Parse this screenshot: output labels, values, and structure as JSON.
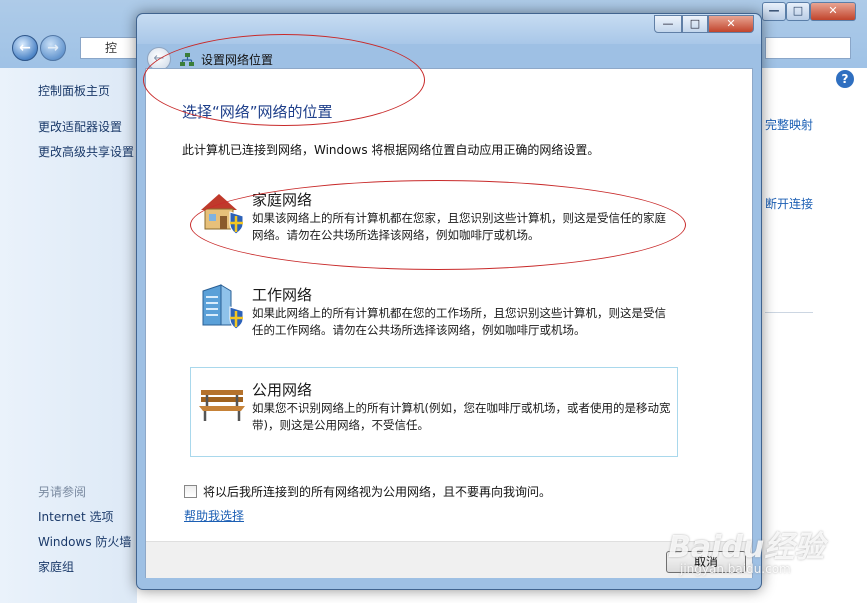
{
  "background_window": {
    "address_text": "控",
    "sidebar": {
      "home": "控制面板主页",
      "links": [
        "更改适配器设置",
        "更改高级共享设置"
      ],
      "see_also_heading": "另请参阅",
      "see_also": [
        "Internet 选项",
        "Windows 防火墙",
        "家庭组"
      ]
    },
    "right_links": [
      "完整映射",
      "断开连接"
    ],
    "help_glyph": "?"
  },
  "dialog": {
    "title": "设置网络位置",
    "heading": "选择“网络”网络的位置",
    "intro": "此计算机已连接到网络，Windows 将根据网络位置自动应用正确的网络设置。",
    "options": [
      {
        "title": "家庭网络",
        "desc": "如果该网络上的所有计算机都在您家，且您识别这些计算机，则这是受信任的家庭网络。请勿在公共场所选择该网络，例如咖啡厅或机场。",
        "icon": "home-icon"
      },
      {
        "title": "工作网络",
        "desc": "如果此网络上的所有计算机都在您的工作场所，且您识别这些计算机，则这是受信任的工作网络。请勿在公共场所选择该网络，例如咖啡厅或机场。",
        "icon": "office-building-icon"
      },
      {
        "title": "公用网络",
        "desc": "如果您不识别网络上的所有计算机(例如，您在咖啡厅或机场，或者使用的是移动宽带)，则这是公用网络，不受信任。",
        "icon": "park-bench-icon"
      }
    ],
    "checkbox_label": "将以后我所连接到的所有网络视为公用网络，且不要再向我询问。",
    "help_link": "帮助我选择",
    "cancel": "取消",
    "window_buttons": {
      "minimize": "—",
      "maximize": "□",
      "close": "✕"
    }
  },
  "watermark": {
    "logo": "Baidu经验",
    "url": "jingyan.baidu.com"
  },
  "colors": {
    "link": "#1c5fb4",
    "heading": "#1e3f8a",
    "annotation": "#c82a2a"
  }
}
